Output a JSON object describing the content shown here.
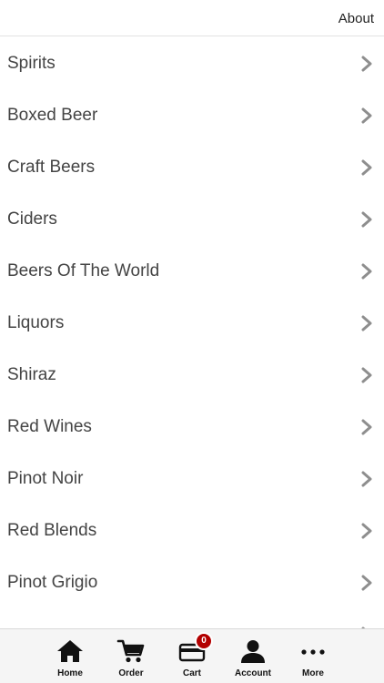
{
  "header": {
    "about_label": "About"
  },
  "menu": {
    "items": [
      {
        "label": "Spirits"
      },
      {
        "label": "Boxed Beer"
      },
      {
        "label": "Craft Beers"
      },
      {
        "label": "Ciders"
      },
      {
        "label": "Beers Of The World"
      },
      {
        "label": "Liquors"
      },
      {
        "label": "Shiraz"
      },
      {
        "label": "Red Wines"
      },
      {
        "label": "Pinot Noir"
      },
      {
        "label": "Red Blends"
      },
      {
        "label": "Pinot Grigio"
      }
    ],
    "chevron_icon": "chevron-right-icon"
  },
  "tabbar": {
    "home_label": "Home",
    "order_label": "Order",
    "cart_label": "Cart",
    "cart_count": "0",
    "account_label": "Account",
    "more_label": "More"
  },
  "colors": {
    "badge": "#b30000",
    "text": "#444444",
    "chevron": "#8e8e8e"
  }
}
